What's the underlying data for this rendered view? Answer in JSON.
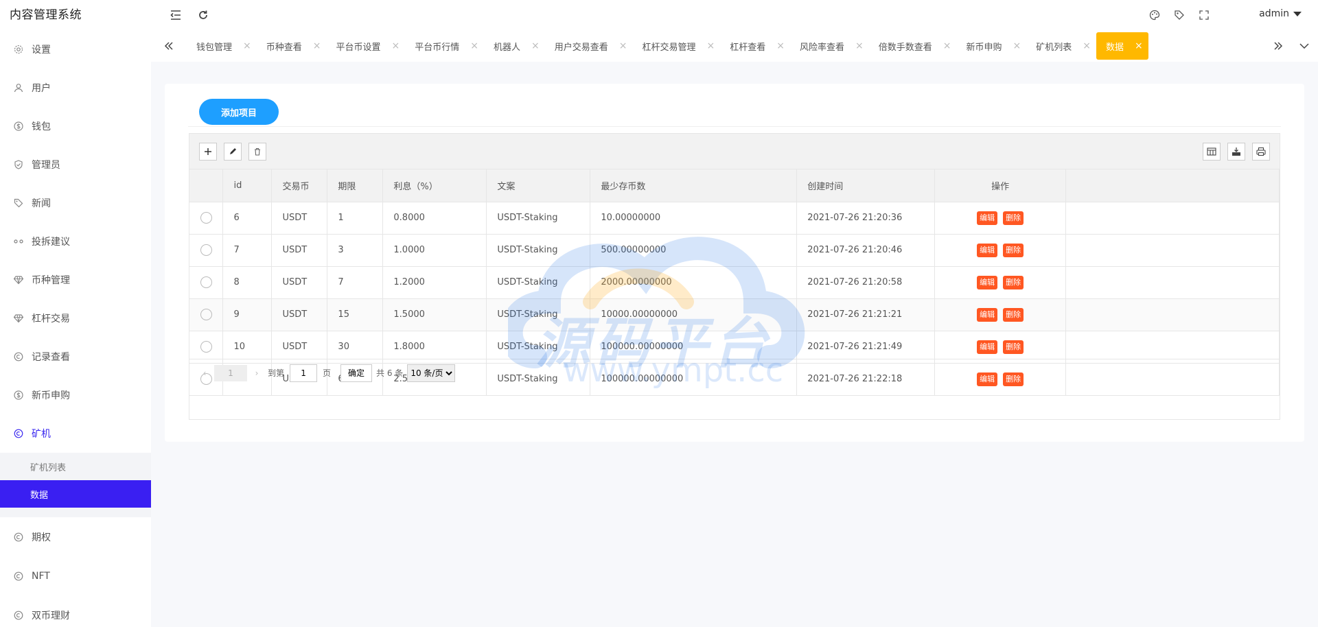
{
  "app": {
    "title": "内容管理系统"
  },
  "topbar": {
    "user": "admin"
  },
  "sidebar": {
    "items": [
      {
        "label": "设置",
        "icon": "gear-icon"
      },
      {
        "label": "用户",
        "icon": "user-icon"
      },
      {
        "label": "钱包",
        "icon": "dollar-icon"
      },
      {
        "label": "管理员",
        "icon": "shield-icon"
      },
      {
        "label": "新闻",
        "icon": "tag-icon"
      },
      {
        "label": "投拆建议",
        "icon": "link-icon"
      },
      {
        "label": "币种管理",
        "icon": "diamond-icon"
      },
      {
        "label": "杠杆交易",
        "icon": "diamond-icon"
      },
      {
        "label": "记录查看",
        "icon": "circle-icon"
      },
      {
        "label": "新币申购",
        "icon": "dollar-icon"
      },
      {
        "label": "矿机",
        "icon": "circle-icon"
      }
    ],
    "submenu": [
      {
        "label": "矿机列表"
      },
      {
        "label": "数据"
      }
    ],
    "items_after": [
      {
        "label": "期权",
        "icon": "circle-icon"
      },
      {
        "label": "NFT",
        "icon": "circle-icon"
      },
      {
        "label": "双币理财",
        "icon": "circle-icon"
      }
    ]
  },
  "tabs": [
    {
      "label": "钱包管理"
    },
    {
      "label": "币种查看"
    },
    {
      "label": "平台币设置"
    },
    {
      "label": "平台币行情"
    },
    {
      "label": "机器人"
    },
    {
      "label": "用户交易查看"
    },
    {
      "label": "杠杆交易管理"
    },
    {
      "label": "杠杆查看"
    },
    {
      "label": "风险率查看"
    },
    {
      "label": "倍数手数查看"
    },
    {
      "label": "新币申购"
    },
    {
      "label": "矿机列表"
    },
    {
      "label": "数据"
    }
  ],
  "tab_close": "×",
  "main": {
    "add_button": "添加项目",
    "columns": [
      "id",
      "交易币",
      "期限",
      "利息（%）",
      "文案",
      "最少存币数",
      "创建时间",
      "操作"
    ],
    "rows": [
      [
        "6",
        "USDT",
        "1",
        "0.8000",
        "USDT-Staking",
        "10.00000000",
        "2021-07-26 21:20:36"
      ],
      [
        "7",
        "USDT",
        "3",
        "1.0000",
        "USDT-Staking",
        "500.00000000",
        "2021-07-26 21:20:46"
      ],
      [
        "8",
        "USDT",
        "7",
        "1.2000",
        "USDT-Staking",
        "2000.00000000",
        "2021-07-26 21:20:58"
      ],
      [
        "9",
        "USDT",
        "15",
        "1.5000",
        "USDT-Staking",
        "10000.00000000",
        "2021-07-26 21:21:21"
      ],
      [
        "10",
        "USDT",
        "30",
        "1.8000",
        "USDT-Staking",
        "100000.00000000",
        "2021-07-26 21:21:49"
      ],
      [
        "12",
        "USDT",
        "60",
        "2.5000",
        "USDT-Staking",
        "100000.00000000",
        "2021-07-26 21:22:18"
      ]
    ],
    "edit_label": "编辑",
    "delete_label": "删除"
  },
  "pager": {
    "current": "1",
    "goto_label": "到第",
    "goto_value": "1",
    "page_unit": "页",
    "confirm": "确定",
    "total": "共 6 条",
    "page_size": "10 条/页"
  },
  "watermark": {
    "text": "源码平台",
    "url": "www.ympt.cc"
  },
  "colors": {
    "accent": "#3a1ff2",
    "active_tab": "#ffb800",
    "add_button": "#1e9fff",
    "danger": "#ff5722"
  }
}
